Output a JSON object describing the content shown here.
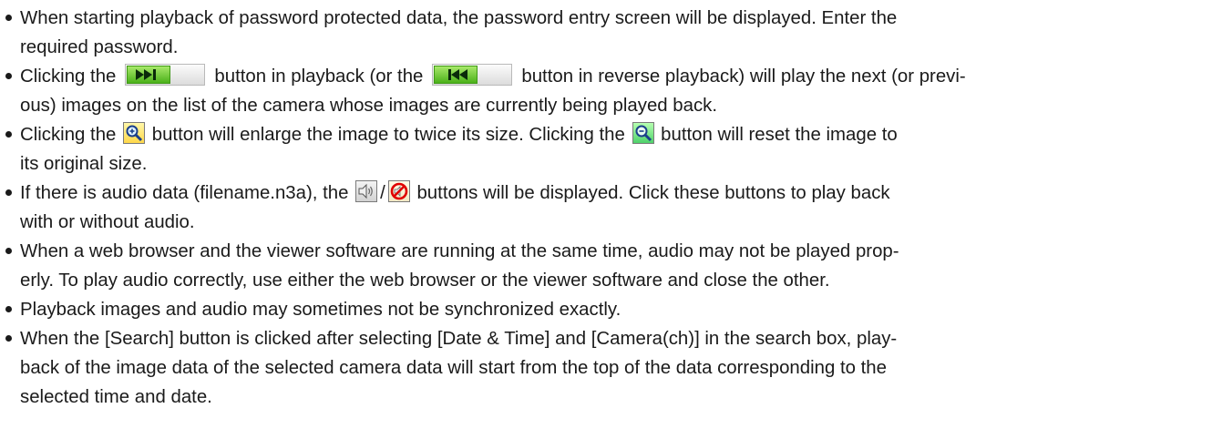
{
  "notes": [
    {
      "line1": "When starting playback of password protected data, the password entry screen will be displayed. Enter the",
      "line2": "required password."
    },
    {
      "line1_a": "Clicking the",
      "line1_b": "button in playback (or the",
      "line1_c": "button in reverse playback) will play the next (or previ-",
      "line2": "ous) images on the list of the camera whose images are currently being played back."
    },
    {
      "line1_a": "Clicking the",
      "line1_b": "button will enlarge the image to twice its size. Clicking the",
      "line1_c": "button will reset the image to",
      "line2": "its original size."
    },
    {
      "line1_a": "If there is audio data (filename.n3a), the",
      "separator": "/",
      "line1_b": "buttons will be displayed. Click these buttons to play back",
      "line2": "with or without audio."
    },
    {
      "line1": "When a web browser and the viewer software are running at the same time, audio may not be played prop-",
      "line2": "erly. To play audio correctly, use either the web browser or the viewer software and close the other."
    },
    {
      "line1": "Playback images and audio may sometimes not be synchronized exactly."
    },
    {
      "line1": "When the [Search] button is clicked after selecting [Date & Time] and [Camera(ch)] in the search box, play-",
      "line2": "back of the image data of the selected camera data will start from the top of the data corresponding to the",
      "line3": "selected time and date."
    }
  ],
  "icons": {
    "next": "skip-next-icon",
    "previous": "skip-previous-icon",
    "zoom_in": "zoom-in-icon",
    "zoom_reset": "zoom-reset-icon",
    "audio_on": "speaker-icon",
    "audio_off": "mute-icon"
  },
  "colors": {
    "text": "#1a1a1a",
    "button_green": "#4bb11a",
    "button_dark": "#0a2a0a"
  }
}
